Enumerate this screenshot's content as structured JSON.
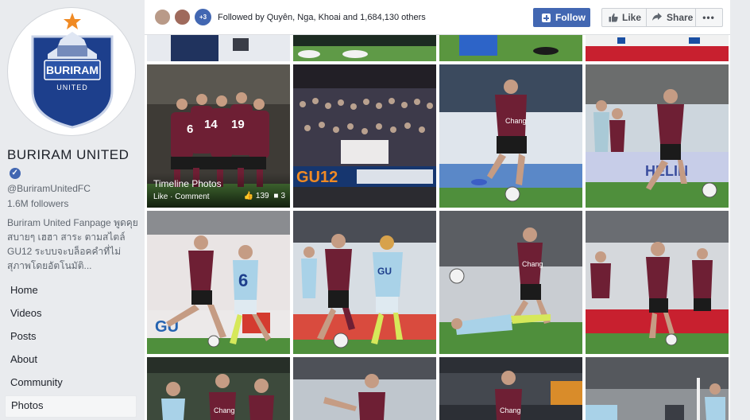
{
  "page": {
    "name": "BURIRAM UNITED",
    "handle": "@BuriramUnitedFC",
    "followers": "1.6M followers",
    "about": "Buriram United Fanpage พูดคุย สบายๆ เฮฮา สาระ ตามสไตล์ GU12 ระบบจะบล็อคคำที่ไม่สุภาพโดยอัตโนมัติ...",
    "logo_text": "BURIRAM",
    "logo_sub": "UNITED"
  },
  "nav": {
    "items": [
      {
        "label": "Home"
      },
      {
        "label": "Videos"
      },
      {
        "label": "Posts"
      },
      {
        "label": "About"
      },
      {
        "label": "Community"
      },
      {
        "label": "Photos",
        "active": true
      }
    ]
  },
  "topbar": {
    "followed_by": "Followed by Quyên, Nga, Khoai and 1,684,130 others",
    "more_count": "+3",
    "follow_label": "Follow",
    "like_label": "Like",
    "share_label": "Share",
    "more_label": "•••"
  },
  "album": {
    "title": "Timeline Photos",
    "like_comment": "Like · Comment",
    "likes": "139",
    "comments": "3"
  },
  "colors": {
    "brand_blue": "#4267b2",
    "buriram_navy": "#1d3f8c",
    "jersey_maroon": "#6e1f34",
    "pitch_green": "#4f8f3c"
  }
}
